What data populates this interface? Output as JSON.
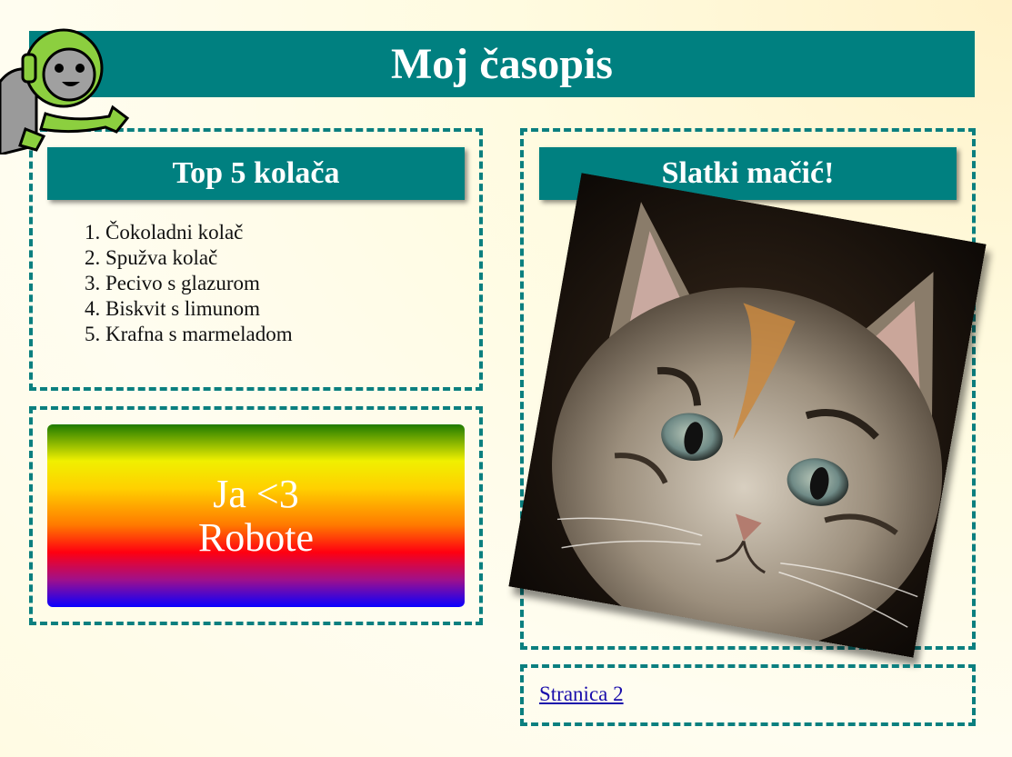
{
  "page": {
    "title": "Moj časopis"
  },
  "cakes": {
    "heading": "Top 5 kolača",
    "items": [
      "Čokoladni kolač",
      "Spužva kolač",
      "Pecivo s glazurom",
      "Biskvit s limunom",
      "Krafna s marmeladom"
    ]
  },
  "robots": {
    "line1": "Ja <3",
    "line2": "Robote"
  },
  "kitten": {
    "heading": "Slatki mačić!"
  },
  "footer": {
    "link_label": "Stranica 2"
  },
  "colors": {
    "teal": "#008080",
    "link": "#1a0dab"
  }
}
